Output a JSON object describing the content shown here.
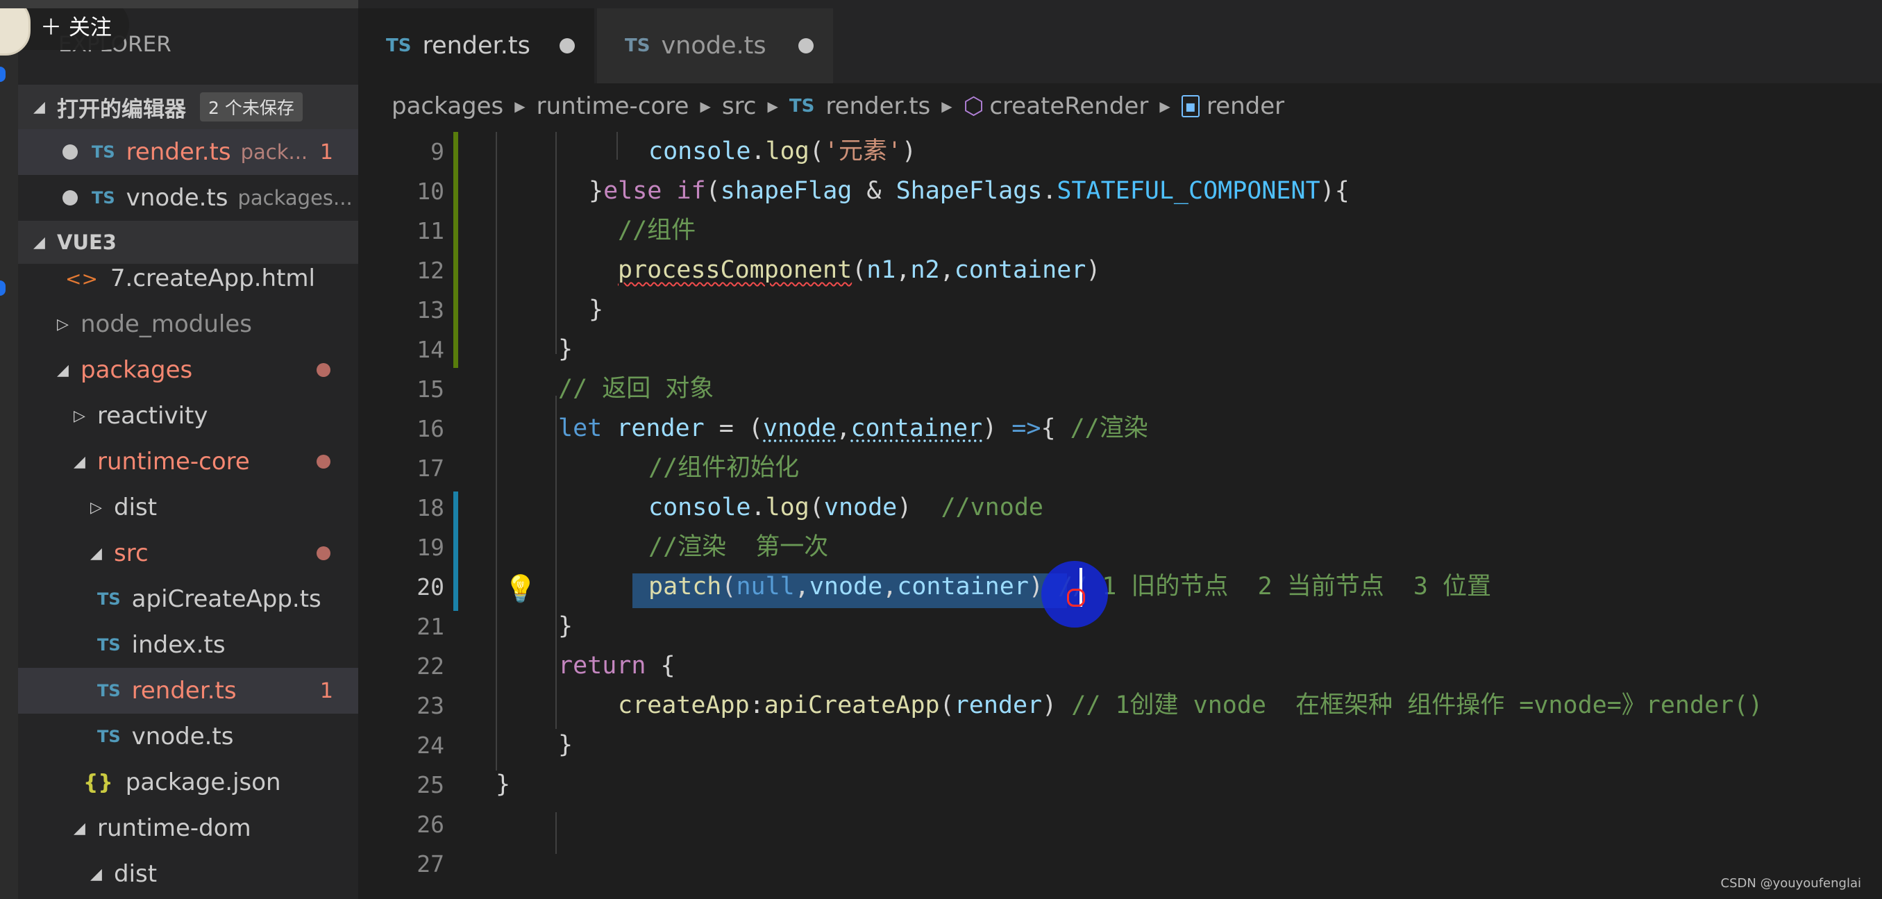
{
  "follow_button": {
    "label": "关注"
  },
  "sidebar": {
    "title": "EXPLORER",
    "open_editors": {
      "label": "打开的编辑器",
      "badge": "2 个未保存",
      "files": [
        {
          "icon": "TS",
          "name": "render.ts",
          "desc": "pack...",
          "errors": "1"
        },
        {
          "icon": "TS",
          "name": "vnode.ts",
          "desc": "packages..."
        }
      ]
    },
    "workspace": {
      "label": "VUE3",
      "tree": [
        {
          "name": "7.createApp.html"
        },
        {
          "name": "node_modules"
        },
        {
          "name": "packages"
        },
        {
          "name": "reactivity"
        },
        {
          "name": "runtime-core"
        },
        {
          "name": "dist"
        },
        {
          "name": "src"
        },
        {
          "name": "apiCreateApp.ts"
        },
        {
          "name": "index.ts"
        },
        {
          "name": "render.ts",
          "errors": "1"
        },
        {
          "name": "vnode.ts"
        },
        {
          "name": "package.json"
        },
        {
          "name": "runtime-dom"
        },
        {
          "name": "dist"
        }
      ]
    }
  },
  "tabs": [
    {
      "icon": "TS",
      "label": "render.ts"
    },
    {
      "icon": "TS",
      "label": "vnode.ts"
    }
  ],
  "breadcrumb": {
    "items": [
      "packages",
      "runtime-core",
      "src",
      "render.ts",
      "createRender",
      "render"
    ],
    "file_icon": "TS"
  },
  "editor": {
    "line_numbers": [
      "9",
      "10",
      "11",
      "12",
      "13",
      "14",
      "15",
      "16",
      "17",
      "18",
      "19",
      "20",
      "21",
      "22",
      "23",
      "24",
      "25",
      "26",
      "27"
    ],
    "lines": {
      "l9_call": "console",
      "l9_dot": ".",
      "l9_fn": "log",
      "l9_open": "(",
      "l9_str": "'元素'",
      "l9_close": ")",
      "l10_a": "}",
      "l10_else": "else",
      "l10_if": "if",
      "l10_b": "(",
      "l10_v1": "shapeFlag",
      "l10_amp": " & ",
      "l10_v2": "ShapeFlags",
      "l10_dot": ".",
      "l10_const": "STATEFUL_COMPONENT",
      "l10_c": "){",
      "l11": "//组件",
      "l12_fn": "processComponent",
      "l12_open": "(",
      "l12_a1": "n1",
      "l12_c1": ",",
      "l12_a2": "n2",
      "l12_c2": ",",
      "l12_a3": "container",
      "l12_close": ")",
      "l13": "}",
      "l14": "}",
      "l15": "// 返回 对象",
      "l16_let": "let",
      "l16_name": " render",
      "l16_eq": " = (",
      "l16_p1": "vnode",
      "l16_c": ",",
      "l16_p2": "container",
      "l16_cl": ") ",
      "l16_arrow": "=>",
      "l16_br": "{ ",
      "l16_cmt": "//渲染",
      "l17": "//组件初始化",
      "l18_obj": "console",
      "l18_dot": ".",
      "l18_fn": "log",
      "l18_open": "(",
      "l18_arg": "vnode",
      "l18_close": ")",
      "l18_cmt": "  //vnode",
      "l19": "//渲染  第一次",
      "l20_fn": "patch",
      "l20_open": "(",
      "l20_null": "null",
      "l20_c1": ",",
      "l20_a2": "vnode",
      "l20_c2": ",",
      "l20_a3": "container",
      "l20_close": ")",
      "l20_cmt": "// 1 旧的节点  2 当前节点  3 位置",
      "l21": "}",
      "l22_ret": "return",
      "l22_br": " {",
      "l23_key": "createApp",
      "l23_colon": ":",
      "l23_fn": "apiCreateApp",
      "l23_open": "(",
      "l23_arg": "render",
      "l23_close": ")",
      "l23_cmt": " // 1创建 vnode  在框架种 组件操作 =vnode=》render()",
      "l24": "}",
      "l25": "}"
    }
  },
  "watermark": "CSDN @youyoufenglai",
  "colors": {
    "background": "#1e1e1e",
    "sidebar": "#252526",
    "selection": "#264f78",
    "typescript_icon": "#519aba",
    "error_text": "#f48771"
  }
}
